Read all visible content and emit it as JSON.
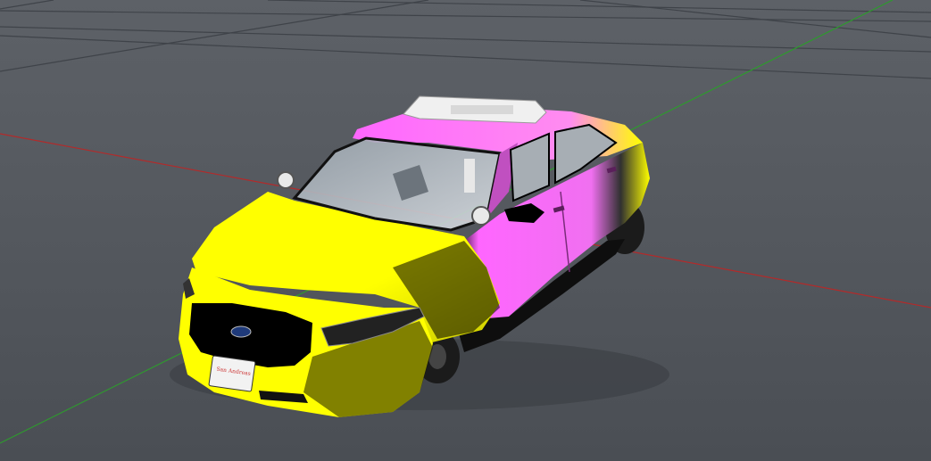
{
  "viewport": {
    "type": "3d-model-preview",
    "background_color": "#55595f",
    "grid_line_color": "#3f4349",
    "axis_x_color": "#b32a2a",
    "axis_y_color": "#2e9a2e"
  },
  "model": {
    "kind": "police sedan",
    "colors": {
      "primary": "#ffff00",
      "secondary": "#ff66ff",
      "grille": "#000000",
      "lightbar": "#eeeeee"
    },
    "license_plate": {
      "text": "San Andreas",
      "color": "#cc3333"
    }
  }
}
